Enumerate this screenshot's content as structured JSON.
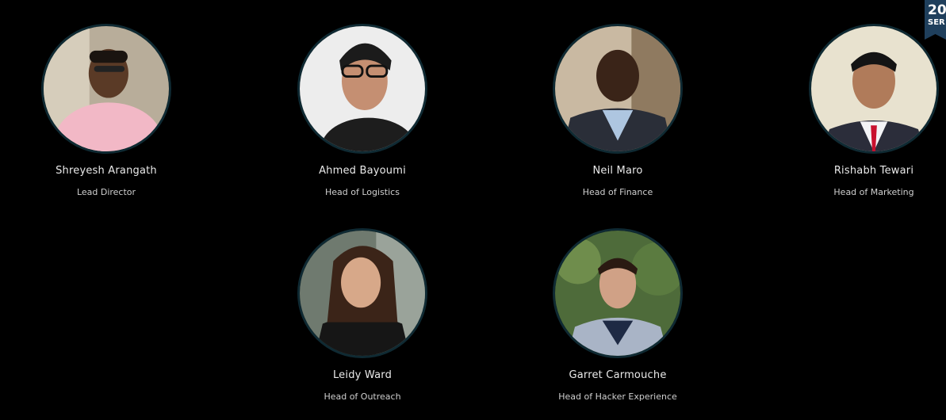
{
  "badge": {
    "line1": "20",
    "line2": "SER"
  },
  "members": [
    {
      "name": "Shreyesh Arangath",
      "role": "Lead Director",
      "photo_icon": "person-photo"
    },
    {
      "name": "Ahmed Bayoumi",
      "role": "Head of Logistics",
      "photo_icon": "person-photo"
    },
    {
      "name": "Neil Maro",
      "role": "Head of Finance",
      "photo_icon": "person-photo"
    },
    {
      "name": "Rishabh Tewari",
      "role": "Head of Marketing",
      "photo_icon": "person-photo"
    },
    {
      "name": "Leidy Ward",
      "role": "Head of Outreach",
      "photo_icon": "person-photo"
    },
    {
      "name": "Garret Carmouche",
      "role": "Head of Hacker Experience",
      "photo_icon": "person-photo"
    }
  ],
  "colors": {
    "background": "#000000",
    "avatar_ring": "#0f2a33",
    "badge": "#1f3f5c"
  }
}
